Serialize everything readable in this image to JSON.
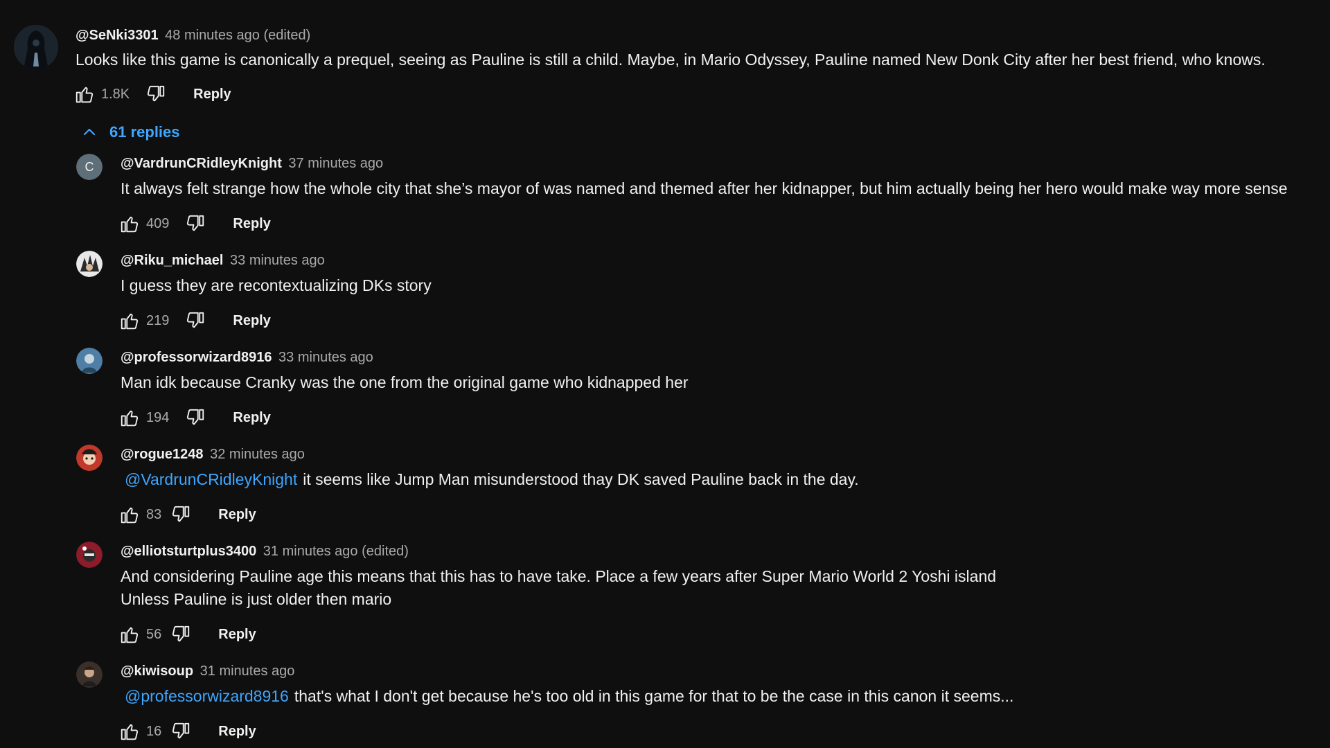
{
  "top_comment": {
    "author": "@SeNki3301",
    "time": "48 minutes ago (edited)",
    "text": "Looks like this game is canonically a prequel, seeing as Pauline is still a child. Maybe, in Mario Odyssey, Pauline named New Donk City after her best friend, who knows.",
    "likes": "1.8K",
    "reply_label": "Reply",
    "avatar_icon": "hooded-figure-avatar"
  },
  "replies_toggle": {
    "label": "61 replies",
    "icon": "chevron-up-icon"
  },
  "replies": [
    {
      "author": "@VardrunCRidleyKnight",
      "time": "37 minutes ago",
      "mention": "",
      "text": "It always felt strange how the whole city that she’s mayor of was named and themed after her kidnapper, but him actually being her hero would make way more sense",
      "text2": "",
      "likes": "409",
      "reply_label": "Reply",
      "avatar_letter": "C",
      "avatar_color": "#5f6f7a"
    },
    {
      "author": "@Riku_michael",
      "time": "33 minutes ago",
      "mention": "",
      "text": "I guess they are recontextualizing DKs story",
      "text2": "",
      "likes": "219",
      "reply_label": "Reply",
      "avatar_letter": "",
      "avatar_color": "#e8e8e8"
    },
    {
      "author": "@professorwizard8916",
      "time": "33 minutes ago",
      "mention": "",
      "text": "Man idk because Cranky was the one from the original game who kidnapped her",
      "text2": "",
      "likes": "194",
      "reply_label": "Reply",
      "avatar_letter": "",
      "avatar_color": "#4f7fa6"
    },
    {
      "author": "@rogue1248",
      "time": "32 minutes ago",
      "mention": "@VardrunCRidleyKnight",
      "text": "it seems like Jump Man misunderstood thay DK saved Pauline back in the day.",
      "text2": "",
      "likes": "83",
      "reply_label": "Reply",
      "avatar_letter": "",
      "avatar_color": "#c0392b"
    },
    {
      "author": "@elliotsturtplus3400",
      "time": "31 minutes ago (edited)",
      "mention": "",
      "text": "And considering Pauline age this means that this has to have take. Place a few years after Super Mario World 2 Yoshi island",
      "text2": "Unless Pauline is just older then mario",
      "likes": "56",
      "reply_label": "Reply",
      "avatar_letter": "",
      "avatar_color": "#8e1b2a"
    },
    {
      "author": "@kiwisoup",
      "time": "31 minutes ago",
      "mention": "@professorwizard8916",
      "text": "that's what I don't get because he's too old in this game for that to be the case in this canon it seems...",
      "text2": "",
      "likes": "16",
      "reply_label": "Reply",
      "avatar_letter": "",
      "avatar_color": "#3a2f2a"
    }
  ]
}
